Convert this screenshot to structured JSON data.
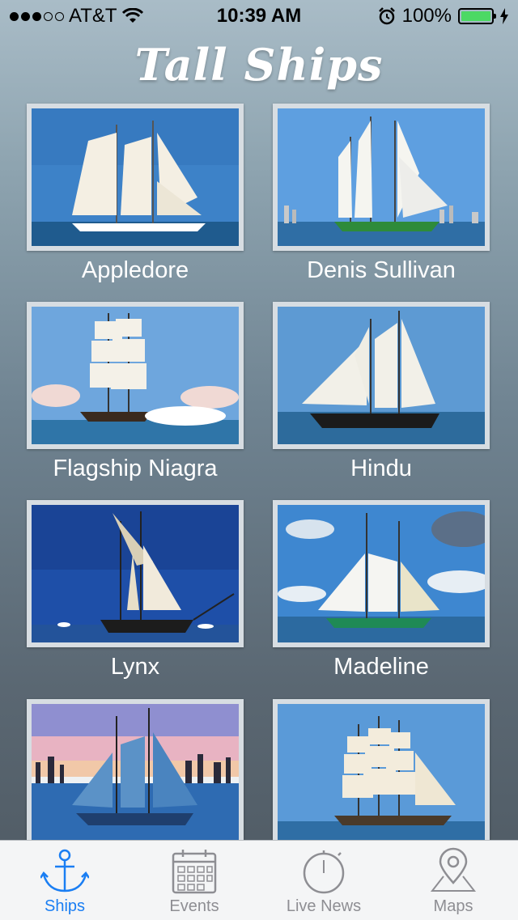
{
  "status": {
    "carrier": "AT&T",
    "time": "10:39 AM",
    "battery": "100%"
  },
  "app": {
    "title": "Tall Ships"
  },
  "ships": [
    {
      "name": "Appledore"
    },
    {
      "name": "Denis Sullivan"
    },
    {
      "name": "Flagship Niagra"
    },
    {
      "name": "Hindu"
    },
    {
      "name": "Lynx"
    },
    {
      "name": "Madeline"
    },
    {
      "name": ""
    },
    {
      "name": ""
    }
  ],
  "tabs": [
    {
      "label": "Ships",
      "icon": "anchor-icon",
      "active": true
    },
    {
      "label": "Events",
      "icon": "calendar-icon"
    },
    {
      "label": "Live News",
      "icon": "stopwatch-icon"
    },
    {
      "label": "Maps",
      "icon": "map-pin-icon"
    }
  ],
  "colors": {
    "accent": "#1a7ef3",
    "inactive": "#8e8e93"
  }
}
